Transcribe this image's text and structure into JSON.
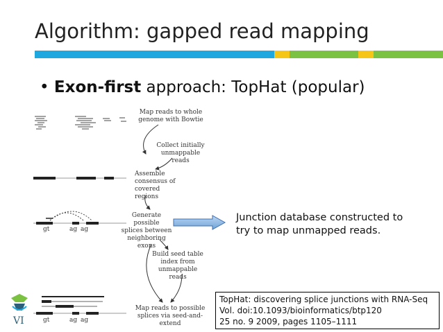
{
  "slide": {
    "title": "Algorithm: gapped read mapping",
    "bullet_bold": "Exon-first",
    "bullet_rest": " approach: TopHat (popular)",
    "colors": {
      "blue": "#1fa8e0",
      "yellow": "#f5c518",
      "green": "#7cc242"
    }
  },
  "flowchart": {
    "steps": [
      "Map reads to whole\ngenome with Bowtie",
      "Collect initially\nunmappable reads",
      "Assemble\nconsensus of\ncovered regions",
      "Generate possible\nsplices between\nneighboring\nexons",
      "Build seed table\nindex from\nunmappable reads",
      "Map reads to possible\nsplices via seed-and-\nextend"
    ],
    "site_labels": [
      "gt",
      "ag",
      "ag"
    ]
  },
  "callout": {
    "text": "Junction database constructed to\ntry to map unmapped reads."
  },
  "citation": {
    "line1": "TopHat: discovering splice junctions with RNA-Seq",
    "line2": "Vol. doi:10.1093/bioinformatics/btp120",
    "line3": "25 no. 9 2009, pages 1105–1111"
  },
  "logo": {
    "text": "VI"
  }
}
